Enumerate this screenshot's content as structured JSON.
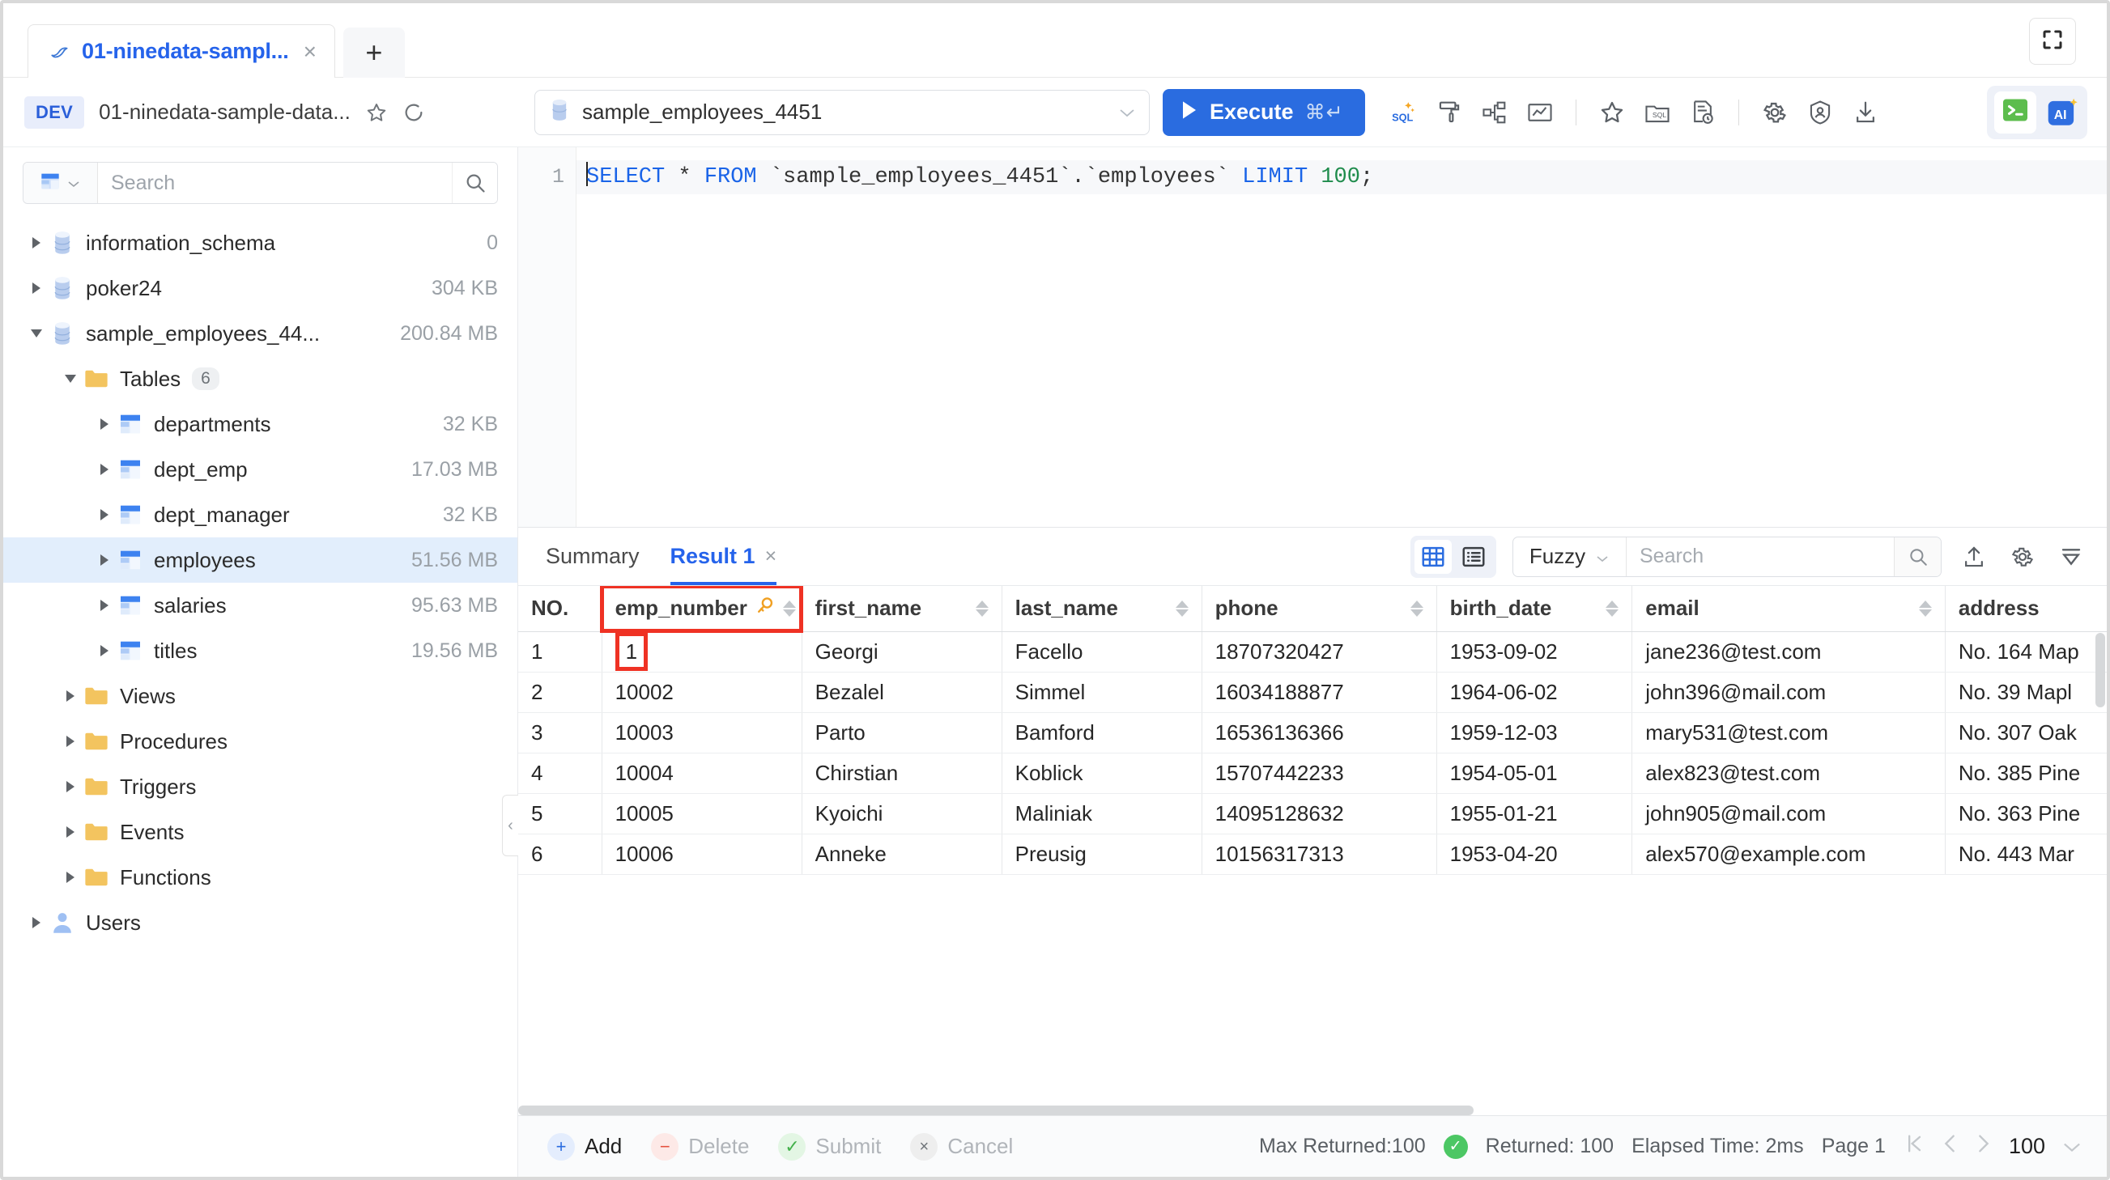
{
  "window": {
    "fullscreen_icon": "fullscreen-icon"
  },
  "tabbar": {
    "tabs": [
      {
        "label": "01-ninedata-sampl...",
        "icon": "mysql-dolphin-icon",
        "close": "×",
        "active": true
      }
    ],
    "add_label": "+"
  },
  "connection": {
    "env_badge": "DEV",
    "name": "01-ninedata-sample-data...",
    "star_icon": "star-icon",
    "refresh_icon": "refresh-icon"
  },
  "toolbar": {
    "database_selected": "sample_employees_4451",
    "database_icon": "database-icon",
    "dropdown_icon": "chevron-down-icon",
    "execute_label": "Execute",
    "execute_shortcut": "⌘↵",
    "icons": [
      "ai-sql-icon",
      "format-sql-icon",
      "explain-plan-icon",
      "visual-chart-icon",
      "favorite-star-icon",
      "sql-folder-icon",
      "query-history-icon",
      "settings-gear-icon",
      "security-shield-icon",
      "download-icon"
    ],
    "terminal_icon": "terminal-icon",
    "ai_icon": "ai-assistant-icon",
    "ai_label": "AI"
  },
  "sidebar": {
    "search": {
      "placeholder": "Search",
      "value": "",
      "type_icon": "table-filter-icon",
      "go_icon": "search-icon"
    },
    "tree": [
      {
        "label": "information_schema",
        "meta": "0",
        "icon": "database-icon",
        "depth": 0,
        "expanded": false,
        "selected": false
      },
      {
        "label": "poker24",
        "meta": "304 KB",
        "icon": "database-icon",
        "depth": 0,
        "expanded": false,
        "selected": false
      },
      {
        "label": "sample_employees_44...",
        "meta": "200.84 MB",
        "icon": "database-icon",
        "depth": 0,
        "expanded": true,
        "selected": false
      },
      {
        "label": "Tables",
        "count": "6",
        "icon": "folder-icon",
        "depth": 1,
        "expanded": true,
        "selected": false
      },
      {
        "label": "departments",
        "meta": "32 KB",
        "icon": "table-icon",
        "depth": 2,
        "expanded": false,
        "selected": false
      },
      {
        "label": "dept_emp",
        "meta": "17.03 MB",
        "icon": "table-icon",
        "depth": 2,
        "expanded": false,
        "selected": false
      },
      {
        "label": "dept_manager",
        "meta": "32 KB",
        "icon": "table-icon",
        "depth": 2,
        "expanded": false,
        "selected": false
      },
      {
        "label": "employees",
        "meta": "51.56 MB",
        "icon": "table-icon",
        "depth": 2,
        "expanded": false,
        "selected": true
      },
      {
        "label": "salaries",
        "meta": "95.63 MB",
        "icon": "table-icon",
        "depth": 2,
        "expanded": false,
        "selected": false
      },
      {
        "label": "titles",
        "meta": "19.56 MB",
        "icon": "table-icon",
        "depth": 2,
        "expanded": false,
        "selected": false
      },
      {
        "label": "Views",
        "icon": "folder-icon",
        "depth": 1,
        "expanded": false,
        "selected": false
      },
      {
        "label": "Procedures",
        "icon": "folder-icon",
        "depth": 1,
        "expanded": false,
        "selected": false
      },
      {
        "label": "Triggers",
        "icon": "folder-icon",
        "depth": 1,
        "expanded": false,
        "selected": false
      },
      {
        "label": "Events",
        "icon": "folder-icon",
        "depth": 1,
        "expanded": false,
        "selected": false
      },
      {
        "label": "Functions",
        "icon": "folder-icon",
        "depth": 1,
        "expanded": false,
        "selected": false
      },
      {
        "label": "Users",
        "icon": "users-icon",
        "depth": 0,
        "expanded": false,
        "selected": false
      }
    ],
    "collapse_icon": "‹"
  },
  "editor": {
    "line_number": "1",
    "sql_tokens": [
      {
        "t": "SELECT",
        "c": "kw"
      },
      {
        "t": " ",
        "c": "op"
      },
      {
        "t": "*",
        "c": "op"
      },
      {
        "t": " ",
        "c": "op"
      },
      {
        "t": "FROM",
        "c": "kw"
      },
      {
        "t": " `sample_employees_4451`.`employees` ",
        "c": "id"
      },
      {
        "t": "LIMIT",
        "c": "kw"
      },
      {
        "t": " ",
        "c": "op"
      },
      {
        "t": "100",
        "c": "num"
      },
      {
        "t": ";",
        "c": "op"
      }
    ],
    "sql_text": "SELECT * FROM `sample_employees_4451`.`employees` LIMIT 100;"
  },
  "results": {
    "tabs": [
      {
        "label": "Summary",
        "active": false,
        "closable": false
      },
      {
        "label": "Result 1",
        "active": true,
        "closable": true,
        "close": "×"
      }
    ],
    "view_grid_icon": "grid-view-icon",
    "view_list_icon": "list-view-icon",
    "search": {
      "mode": "Fuzzy",
      "placeholder": "Search",
      "value": "",
      "go_icon": "search-icon"
    },
    "tool_icons": [
      "export-icon",
      "settings-gear-icon",
      "filter-icon"
    ],
    "columns": [
      {
        "name": "NO.",
        "sortable": false,
        "pk": false,
        "highlighted": false
      },
      {
        "name": "emp_number",
        "sortable": true,
        "pk": true,
        "pk_icon": "key-search-icon",
        "highlighted": true
      },
      {
        "name": "first_name",
        "sortable": true,
        "pk": false,
        "highlighted": false
      },
      {
        "name": "last_name",
        "sortable": true,
        "pk": false,
        "highlighted": false
      },
      {
        "name": "phone",
        "sortable": true,
        "pk": false,
        "highlighted": false
      },
      {
        "name": "birth_date",
        "sortable": true,
        "pk": false,
        "highlighted": false
      },
      {
        "name": "email",
        "sortable": true,
        "pk": false,
        "highlighted": false
      },
      {
        "name": "address",
        "sortable": false,
        "pk": false,
        "highlighted": false
      }
    ],
    "rows": [
      {
        "no": "1",
        "emp_number": "1",
        "emp_number_highlighted": true,
        "first_name": "Georgi",
        "last_name": "Facello",
        "phone": "18707320427",
        "birth_date": "1953-09-02",
        "email": "jane236@test.com",
        "address": "No. 164 Map"
      },
      {
        "no": "2",
        "emp_number": "10002",
        "emp_number_highlighted": false,
        "first_name": "Bezalel",
        "last_name": "Simmel",
        "phone": "16034188877",
        "birth_date": "1964-06-02",
        "email": "john396@mail.com",
        "address": "No. 39 Mapl"
      },
      {
        "no": "3",
        "emp_number": "10003",
        "emp_number_highlighted": false,
        "first_name": "Parto",
        "last_name": "Bamford",
        "phone": "16536136366",
        "birth_date": "1959-12-03",
        "email": "mary531@test.com",
        "address": "No. 307 Oak"
      },
      {
        "no": "4",
        "emp_number": "10004",
        "emp_number_highlighted": false,
        "first_name": "Chirstian",
        "last_name": "Koblick",
        "phone": "15707442233",
        "birth_date": "1954-05-01",
        "email": "alex823@test.com",
        "address": "No. 385 Pine"
      },
      {
        "no": "5",
        "emp_number": "10005",
        "emp_number_highlighted": false,
        "first_name": "Kyoichi",
        "last_name": "Maliniak",
        "phone": "14095128632",
        "birth_date": "1955-01-21",
        "email": "john905@mail.com",
        "address": "No. 363 Pine"
      },
      {
        "no": "6",
        "emp_number": "10006",
        "emp_number_highlighted": false,
        "first_name": "Anneke",
        "last_name": "Preusig",
        "phone": "10156317313",
        "birth_date": "1953-04-20",
        "email": "alex570@example.com",
        "address": "No. 443 Mar"
      }
    ]
  },
  "footer": {
    "actions": [
      {
        "label": "Add",
        "icon": "plus-icon",
        "glyph": "+",
        "enabled": true
      },
      {
        "label": "Delete",
        "icon": "minus-icon",
        "glyph": "−",
        "enabled": false
      },
      {
        "label": "Submit",
        "icon": "check-icon",
        "glyph": "✓",
        "enabled": false
      },
      {
        "label": "Cancel",
        "icon": "cross-icon",
        "glyph": "×",
        "enabled": false
      }
    ],
    "max_returned": "Max Returned:100",
    "returned": "Returned: 100",
    "elapsed": "Elapsed Time: 2ms",
    "page": "Page 1",
    "page_size": "100",
    "nav": {
      "first": "❘‹",
      "prev": "‹",
      "next": "›",
      "size_chevron": "⌄"
    }
  },
  "colors": {
    "accent": "#2563eb",
    "execute_bg": "#2a6ce0",
    "highlight_red": "#ef3224",
    "success_green": "#4cc764",
    "folder_yellow": "#f5c462",
    "terminal_green": "#5cbd4d"
  }
}
